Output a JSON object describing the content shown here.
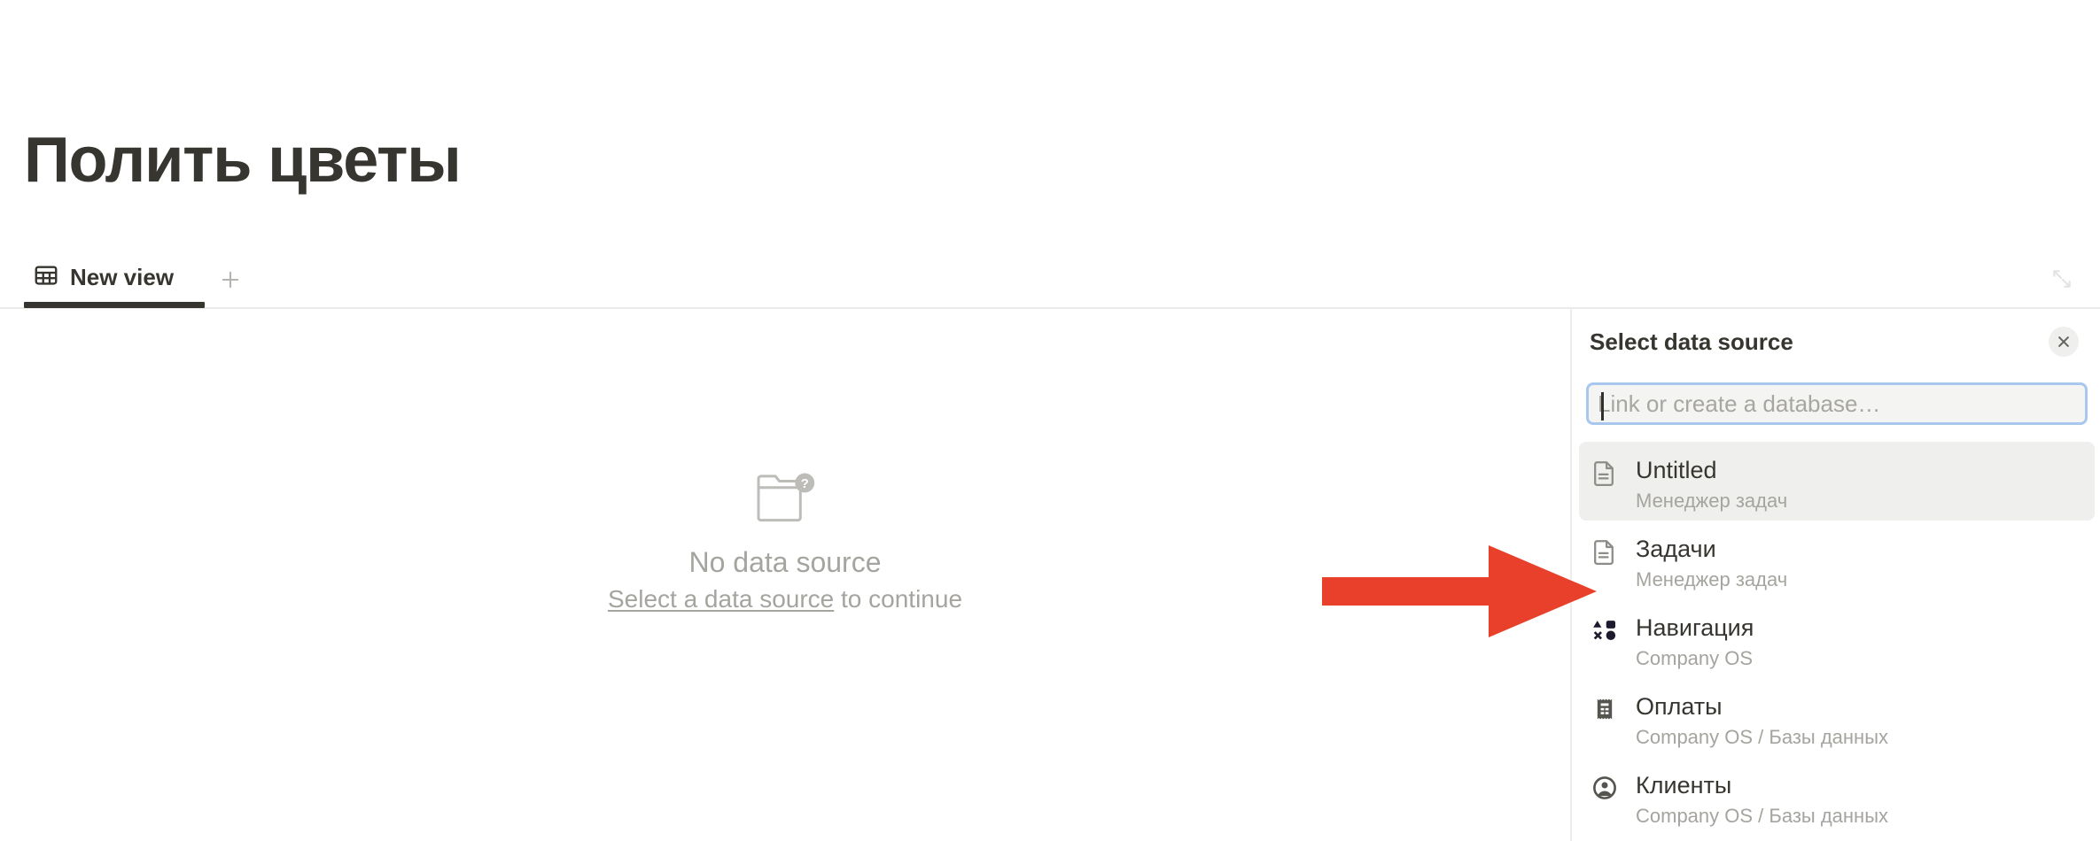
{
  "page": {
    "title": "Полить цветы"
  },
  "tabs": {
    "items": [
      {
        "label": "New view",
        "icon": "table-icon",
        "active": true
      }
    ],
    "add_label": "+",
    "expand_icon": "expand-icon"
  },
  "empty_state": {
    "icon": "folder-question-icon",
    "title": "No data source",
    "link_text": "Select a data source",
    "suffix_text": " to continue"
  },
  "panel": {
    "title": "Select data source",
    "close_icon": "close-icon",
    "search": {
      "value": "",
      "placeholder": "Link or create a database…"
    },
    "results": [
      {
        "title": "Untitled",
        "subtitle": "Менеджер задач",
        "icon": "page-icon",
        "active": true
      },
      {
        "title": "Задачи",
        "subtitle": "Менеджер задач",
        "icon": "page-icon",
        "active": false
      },
      {
        "title": "Навигация",
        "subtitle": "Company OS",
        "icon": "shapes-icon",
        "active": false
      },
      {
        "title": "Оплаты",
        "subtitle": "Company OS / Базы данных",
        "icon": "receipt-icon",
        "active": false
      },
      {
        "title": "Клиенты",
        "subtitle": "Company OS / Базы данных",
        "icon": "person-circle-icon",
        "active": false
      }
    ]
  },
  "annotation": {
    "type": "arrow",
    "direction": "right",
    "color": "#e8402a",
    "points_to": "Задачи"
  },
  "colors": {
    "text": "#37352f",
    "muted": "#a5a49f",
    "hover_bg": "#efefee",
    "focus_ring": "#a8c7ec",
    "input_bg": "#f4f4f3",
    "divider": "#ededec",
    "annotation_red": "#e8402a"
  }
}
